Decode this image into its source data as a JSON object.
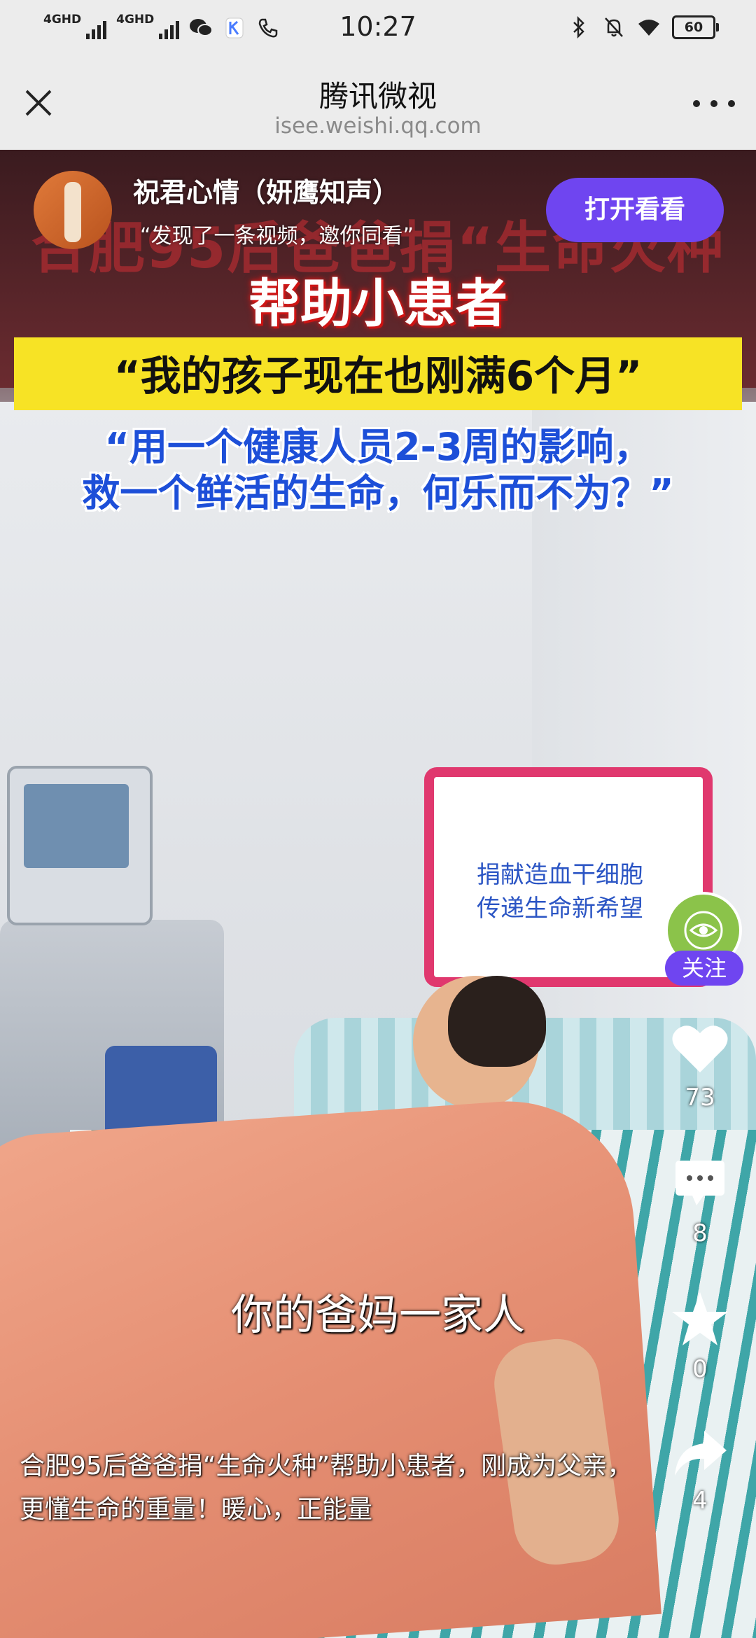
{
  "status_bar": {
    "network1": "4GHD",
    "network2": "4GHD",
    "time": "10:27",
    "battery": "60"
  },
  "nav": {
    "title": "腾讯微视",
    "url": "isee.weishi.qq.com"
  },
  "video": {
    "author_name": "祝君心情（妍鹰知声）",
    "invite_text": "“发现了一条视频，邀你同看”",
    "open_button_label": "打开看看",
    "background_led_text": "合肥95后爸爸捐“生命火种",
    "overlay_title": "帮助小患者",
    "overlay_quote": "“我的孩子现在也刚满6个月”",
    "overlay_blue_line1": "“用一个健康人员2-3周的影响，",
    "overlay_blue_line2": "救一个鲜活的生命，何乐而不为？”",
    "sign_line1": "捐献造血干细胞",
    "sign_line2": "传递生命新希望",
    "subtitle": "你的爸妈一家人",
    "caption": "合肥95后爸爸捐“生命火种”帮助小患者，刚成为父亲，更懂生命的重量！暖心，正能量"
  },
  "rail": {
    "follow_label": "关注",
    "like_count": "73",
    "comment_count": "8",
    "favorite_count": "0",
    "share_count": "4"
  },
  "colors": {
    "accent_purple": "#6f45f0",
    "status_bg": "#ececec",
    "overlay_yellow": "#f7e325",
    "overlay_blue": "#1d4fd8"
  }
}
